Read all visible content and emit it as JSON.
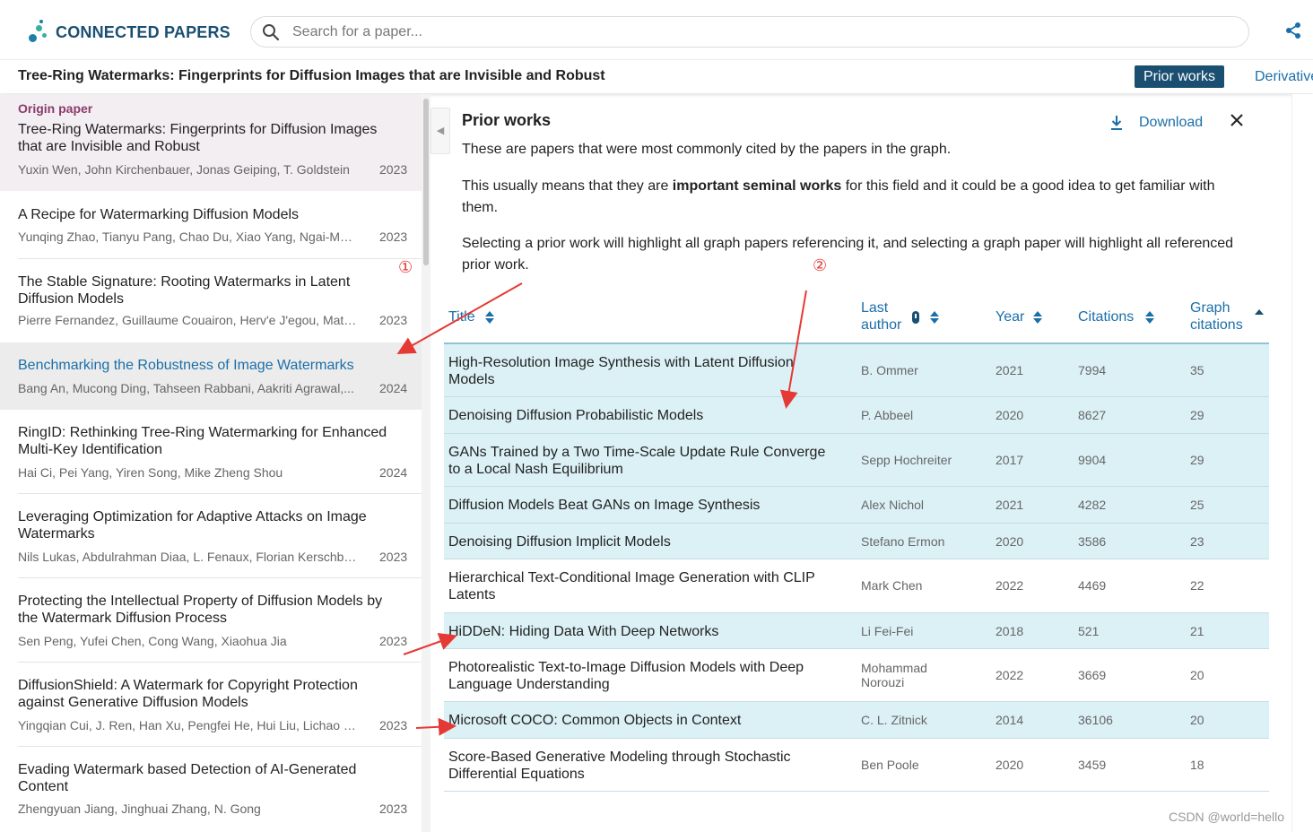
{
  "header": {
    "logo_text": "CONNECTED PAPERS",
    "search_placeholder": "Search for a paper...",
    "share_icon": "share-icon",
    "search_icon": "search-icon"
  },
  "titlebar": {
    "title": "Tree-Ring Watermarks: Fingerprints for Diffusion Images that are Invisible and Robust",
    "prior_label": "Prior works",
    "derivative_label": "Derivative"
  },
  "colors": {
    "brand": "#1b4f72",
    "link": "#1b6fa8",
    "highlight_row": "#dcf1f6",
    "origin_bg": "#f3eef2",
    "origin_label": "#8a3b6b",
    "annotation": "#e53935"
  },
  "left_list": {
    "origin_label": "Origin paper",
    "papers": [
      {
        "title": "Tree-Ring Watermarks: Fingerprints for Diffusion Images that are Invisible and Robust",
        "authors": "Yuxin Wen, John Kirchenbauer, Jonas Geiping, T. Goldstein",
        "year": "2023"
      },
      {
        "title": "A Recipe for Watermarking Diffusion Models",
        "authors": "Yunqing Zhao, Tianyu Pang, Chao Du, Xiao Yang, Ngai-Man...",
        "year": "2023"
      },
      {
        "title": "The Stable Signature: Rooting Watermarks in Latent Diffusion Models",
        "authors": "Pierre Fernandez, Guillaume Couairon, Herv'e J'egou, Matthijs...",
        "year": "2023"
      },
      {
        "title": "Benchmarking the Robustness of Image Watermarks",
        "authors": "Bang An, Mucong Ding, Tahseen Rabbani, Aakriti Agrawal,...",
        "year": "2024"
      },
      {
        "title": "RingID: Rethinking Tree-Ring Watermarking for Enhanced Multi-Key Identification",
        "authors": "Hai Ci, Pei Yang, Yiren Song, Mike Zheng Shou",
        "year": "2024"
      },
      {
        "title": "Leveraging Optimization for Adaptive Attacks on Image Watermarks",
        "authors": "Nils Lukas, Abdulrahman Diaa, L. Fenaux, Florian Kerschbaum",
        "year": "2023"
      },
      {
        "title": "Protecting the Intellectual Property of Diffusion Models by the Watermark Diffusion Process",
        "authors": "Sen Peng, Yufei Chen, Cong Wang, Xiaohua Jia",
        "year": "2023"
      },
      {
        "title": "DiffusionShield: A Watermark for Copyright Protection against Generative Diffusion Models",
        "authors": "Yingqian Cui, J. Ren, Han Xu, Pengfei He, Hui Liu, Lichao Sun,...",
        "year": "2023"
      },
      {
        "title": "Evading Watermark based Detection of AI-Generated Content",
        "authors": "Zhengyuan Jiang, Jinghuai Zhang, N. Gong",
        "year": "2023"
      }
    ]
  },
  "panel": {
    "title": "Prior works",
    "download_label": "Download",
    "desc1": "These are papers that were most commonly cited by the papers in the graph.",
    "desc2_pre": "This usually means that they are ",
    "desc2_bold": "important seminal works",
    "desc2_post": " for this field and it could be a good idea to get familiar with them.",
    "desc3": "Selecting a prior work will highlight all graph papers referencing it, and selecting a graph paper will highlight all referenced prior work.",
    "columns": {
      "title": "Title",
      "last_author": "Last author",
      "year": "Year",
      "citations": "Citations",
      "graph_citations": "Graph citations"
    },
    "rows": [
      {
        "title": "High-Resolution Image Synthesis with Latent Diffusion Models",
        "author": "B. Ommer",
        "year": "2021",
        "citations": "7994",
        "graph": "35",
        "highlight": true
      },
      {
        "title": "Denoising Diffusion Probabilistic Models",
        "author": "P. Abbeel",
        "year": "2020",
        "citations": "8627",
        "graph": "29",
        "highlight": true
      },
      {
        "title": "GANs Trained by a Two Time-Scale Update Rule Converge to a Local Nash Equilibrium",
        "author": "Sepp Hochreiter",
        "year": "2017",
        "citations": "9904",
        "graph": "29",
        "highlight": true
      },
      {
        "title": "Diffusion Models Beat GANs on Image Synthesis",
        "author": "Alex Nichol",
        "year": "2021",
        "citations": "4282",
        "graph": "25",
        "highlight": true
      },
      {
        "title": "Denoising Diffusion Implicit Models",
        "author": "Stefano Ermon",
        "year": "2020",
        "citations": "3586",
        "graph": "23",
        "highlight": true
      },
      {
        "title": "Hierarchical Text-Conditional Image Generation with CLIP Latents",
        "author": "Mark Chen",
        "year": "2022",
        "citations": "4469",
        "graph": "22",
        "highlight": false
      },
      {
        "title": "HiDDeN: Hiding Data With Deep Networks",
        "author": "Li Fei-Fei",
        "year": "2018",
        "citations": "521",
        "graph": "21",
        "highlight": true
      },
      {
        "title": "Photorealistic Text-to-Image Diffusion Models with Deep Language Understanding",
        "author": "Mohammad Norouzi",
        "year": "2022",
        "citations": "3669",
        "graph": "20",
        "highlight": false
      },
      {
        "title": "Microsoft COCO: Common Objects in Context",
        "author": "C. L. Zitnick",
        "year": "2014",
        "citations": "36106",
        "graph": "20",
        "highlight": true
      },
      {
        "title": "Score-Based Generative Modeling through Stochastic Differential Equations",
        "author": "Ben Poole",
        "year": "2020",
        "citations": "3459",
        "graph": "18",
        "highlight": false
      }
    ]
  },
  "annotations": {
    "mark1": "①",
    "mark2": "②"
  },
  "watermark": "CSDN @world=hello"
}
